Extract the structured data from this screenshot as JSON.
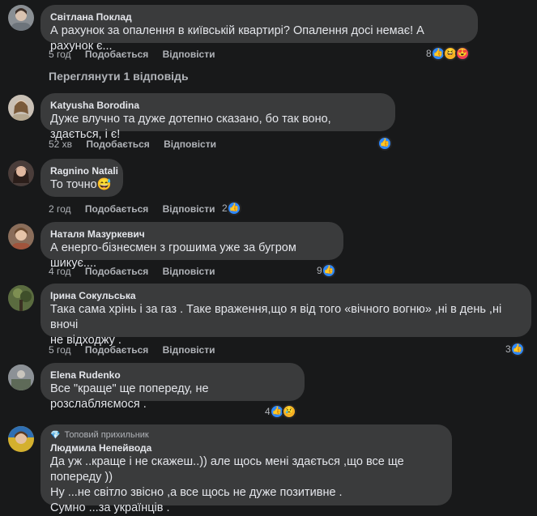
{
  "actions": {
    "like": "Подобається",
    "reply": "Відповісти"
  },
  "view_replies": "Переглянути 1 відповідь",
  "comments": [
    {
      "name": "Світлана Поклад",
      "text": "А рахунок за опалення в київській квартирі? Опалення досі немає! А рахунок є...",
      "time": "5 год",
      "reactions": "8",
      "reaction_icons": [
        "like-icon",
        "haha-icon",
        "love-icon"
      ]
    },
    {
      "name": "Katyusha Borodina",
      "text": "Дуже влучно та дуже дотепно сказано, бо так воно, здається, і є!",
      "time": "52 хв",
      "reactions": "",
      "reaction_icons": [
        "like-icon"
      ]
    },
    {
      "name": "Ragnino Natali",
      "text": "То точно😅",
      "time": "2 год",
      "reactions": "2",
      "reaction_icons": [
        "like-icon"
      ]
    },
    {
      "name": "Наталя Мазуркевич",
      "text": "А енерго-бізнесмен з грошима уже за бугром шикує....",
      "time": "4 год",
      "reactions": "9",
      "reaction_icons": [
        "like-icon"
      ]
    },
    {
      "name": "Ірина Сокульська",
      "text": "Така сама хрінь і за газ . Таке враження,що я від того «вічного вогню» ,ні в день ,ні вночі\nне відходжу .",
      "time": "5 год",
      "reactions": "3",
      "reaction_icons": [
        "like-icon"
      ]
    },
    {
      "name": "Elena Rudenko",
      "text": "Все \"краще\" ще попереду, не розслабляємося .",
      "time": "",
      "reactions": "4",
      "reaction_icons": [
        "like-icon",
        "sad-icon"
      ]
    },
    {
      "badge": "Топовий прихильник",
      "name": "Людмила Непейвода",
      "text": "Да уж ..краще і не скажеш..)) але щось мені здається ,що все ще попереду ))\nНу ...не світло звісно ,а все щось не дуже позитивне .\nСумно ...за українців .",
      "time": "",
      "reactions": "",
      "reaction_icons": []
    }
  ]
}
